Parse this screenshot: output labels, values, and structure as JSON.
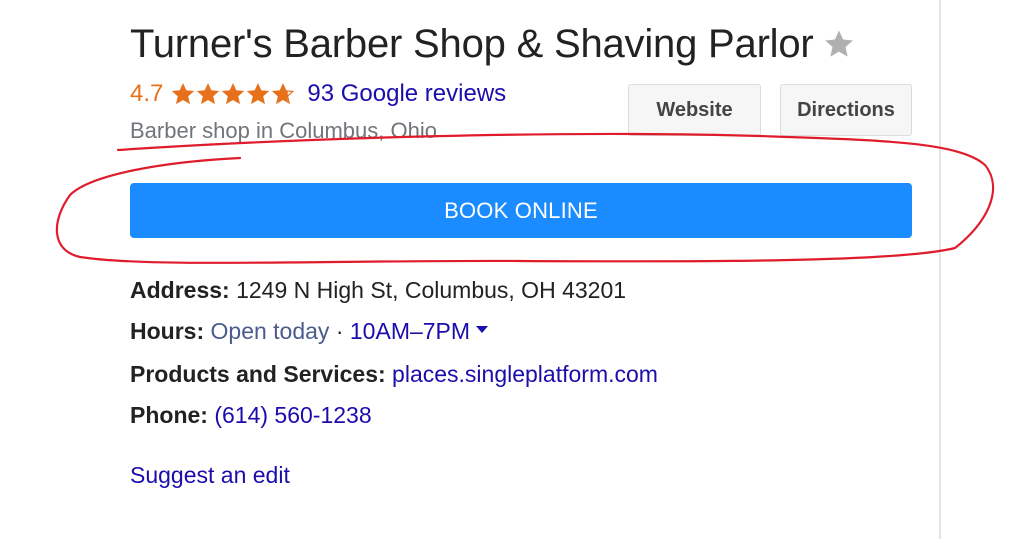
{
  "business": {
    "name": "Turner's Barber Shop & Shaving Parlor",
    "rating": "4.7",
    "stars_value": 4.7,
    "stars_max": 5,
    "reviews_text": "93 Google reviews",
    "category": "Barber shop in Columbus, Ohio"
  },
  "actions": {
    "website_label": "Website",
    "directions_label": "Directions",
    "book_label": "BOOK ONLINE",
    "save_icon": "star-icon"
  },
  "info": {
    "address_label": "Address:",
    "address_value": "1249 N High St, Columbus, OH 43201",
    "hours_label": "Hours:",
    "hours_status": "Open today",
    "hours_separator": " · ",
    "hours_value": "10AM–7PM",
    "products_label": "Products and Services:",
    "products_value": "places.singleplatform.com",
    "phone_label": "Phone:",
    "phone_value": "(614) 560-1238"
  },
  "suggest_edit": "Suggest an edit",
  "colors": {
    "rating_orange": "#e7711b",
    "link_blue": "#1a0dab",
    "book_button_blue": "#1a8cff",
    "annotation_red": "#e01b2c"
  }
}
